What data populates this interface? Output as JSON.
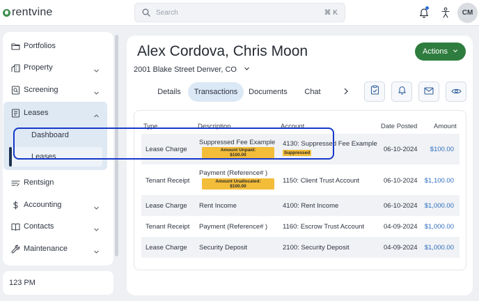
{
  "app": {
    "logo_text": "rentvine",
    "brand_color": "#3e8e4f"
  },
  "topbar": {
    "search_placeholder": "Search",
    "search_shortcut": "⌘ K",
    "avatar_initials": "CM",
    "notification_dot_color": "#2f6fd8"
  },
  "sidebar": {
    "items": [
      {
        "label": "Portfolios",
        "icon": "folder-icon"
      },
      {
        "label": "Property",
        "icon": "building-icon",
        "chevron": "down"
      },
      {
        "label": "Screening",
        "icon": "screening-icon",
        "chevron": "down"
      },
      {
        "label": "Leases",
        "icon": "file-icon",
        "chevron": "up",
        "expanded": true
      },
      {
        "label": "Rentsign",
        "icon": "rentsign-icon"
      },
      {
        "label": "Accounting",
        "icon": "dollar-icon",
        "chevron": "down"
      },
      {
        "label": "Contacts",
        "icon": "book-icon",
        "chevron": "down"
      },
      {
        "label": "Maintenance",
        "icon": "wrench-icon",
        "chevron": "down"
      }
    ],
    "leases_sub": [
      {
        "label": "Dashboard"
      },
      {
        "label": "Leases",
        "active": true
      }
    ],
    "clock": "123 PM"
  },
  "header": {
    "title": "Alex Cordova, Chris Moon",
    "address": "2001 Blake Street Denver, CO",
    "actions_label": "Actions",
    "actions_color": "#2e7d3e"
  },
  "tabs": [
    {
      "label": "Details"
    },
    {
      "label": "Transactions",
      "active": true
    },
    {
      "label": "Documents"
    },
    {
      "label": "Chat"
    }
  ],
  "table": {
    "headers": [
      "Type",
      "Description",
      "Account",
      "Date Posted",
      "Amount"
    ],
    "rows": [
      {
        "type": "Lease Charge",
        "description": "Suppressed Fee Example",
        "badge": "Amount Unpaid:\n$100.00",
        "account": "4130: Suppressed Fee Example",
        "account_tag": "Suppressed",
        "date": "06-10-2024",
        "amount": "$100.00"
      },
      {
        "type": "Tenant Receipt",
        "description": "Payment (Reference# )",
        "badge": "Amount Unallocated:\n$100.00",
        "account": "1150: Client Trust Account",
        "date": "06-10-2024",
        "amount": "$1,100.00",
        "highlighted": true
      },
      {
        "type": "Lease Charge",
        "description": "Rent Income",
        "account": "4100: Rent Income",
        "date": "06-10-2024",
        "amount": "$1,000.00"
      },
      {
        "type": "Tenant Receipt",
        "description": "Payment (Reference# )",
        "account": "1160: Escrow Trust Account",
        "date": "04-09-2024",
        "amount": "$1,000.00"
      },
      {
        "type": "Lease Charge",
        "description": "Security Deposit",
        "account": "2100: Security Deposit",
        "date": "04-09-2024",
        "amount": "$1,000.00"
      }
    ],
    "highlight_color": "#1638c9",
    "badge_color": "#f3bd3a",
    "amount_color": "#2f6fbf"
  }
}
